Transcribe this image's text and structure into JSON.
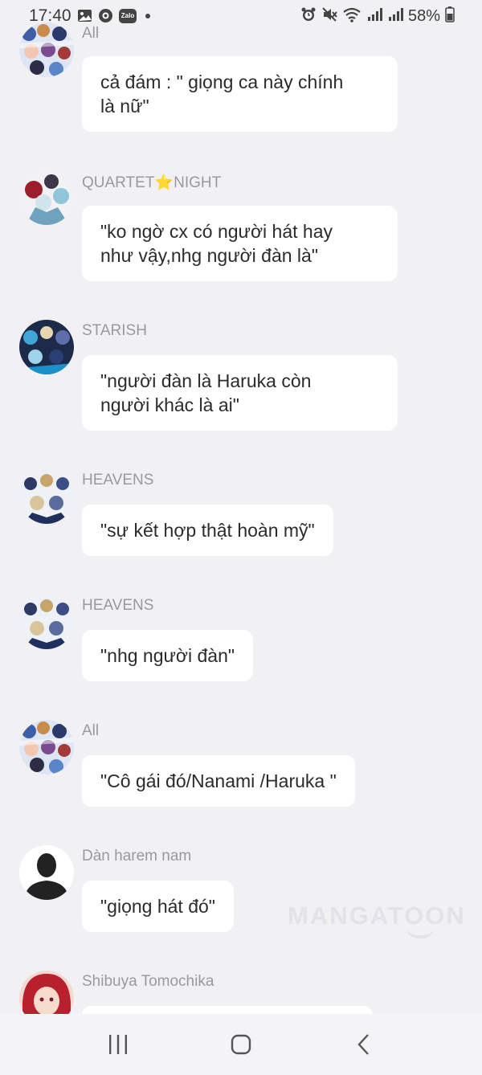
{
  "status_bar": {
    "time": "17:40",
    "left_icons": [
      "image-icon",
      "location-icon",
      "zalo-icon",
      "notification-dot"
    ],
    "zalo_label": "Zalo",
    "right_icons": [
      "alarm-icon",
      "mute-icon",
      "wifi-icon",
      "signal-icon",
      "signal-icon",
      "battery-icon"
    ],
    "battery": "58%"
  },
  "messages": [
    {
      "sender": "All",
      "text_lines": [
        "cả đám : \" giọng ca này chính",
        "là nữ\""
      ],
      "avatar": "group-all"
    },
    {
      "sender": "QUARTET⭐NIGHT",
      "text_lines": [
        "\"ko ngờ cx có người hát hay",
        "như vậy,nhg người đàn là\""
      ],
      "avatar": "quartet-night"
    },
    {
      "sender": "STARISH",
      "text_lines": [
        "\"người đàn là Haruka còn",
        "người khác là ai\""
      ],
      "avatar": "starish"
    },
    {
      "sender": "HEAVENS",
      "text_lines": [
        "\"sự kết hợp thật hoàn mỹ\""
      ],
      "avatar": "heavens"
    },
    {
      "sender": "HEAVENS",
      "text_lines": [
        "\"nhg người đàn\""
      ],
      "avatar": "heavens"
    },
    {
      "sender": "All",
      "text_lines": [
        "\"Cô gái đó/Nanami /Haruka \""
      ],
      "avatar": "group-all"
    },
    {
      "sender": "Dàn harem nam",
      "text_lines": [
        "\"giọng hát đó\""
      ],
      "avatar": "silhouette"
    },
    {
      "sender": "Shibuya Tomochika",
      "text_lines": [],
      "avatar": "shibuya"
    }
  ],
  "watermark": "MANGATOON",
  "nav_bar": {
    "items": [
      "recent-apps-icon",
      "home-icon",
      "back-icon"
    ]
  },
  "colors": {
    "background": "#f1f1f4",
    "bubble": "#ffffff",
    "sender_text": "#9a9a9e",
    "message_text": "#2b2b2b"
  }
}
